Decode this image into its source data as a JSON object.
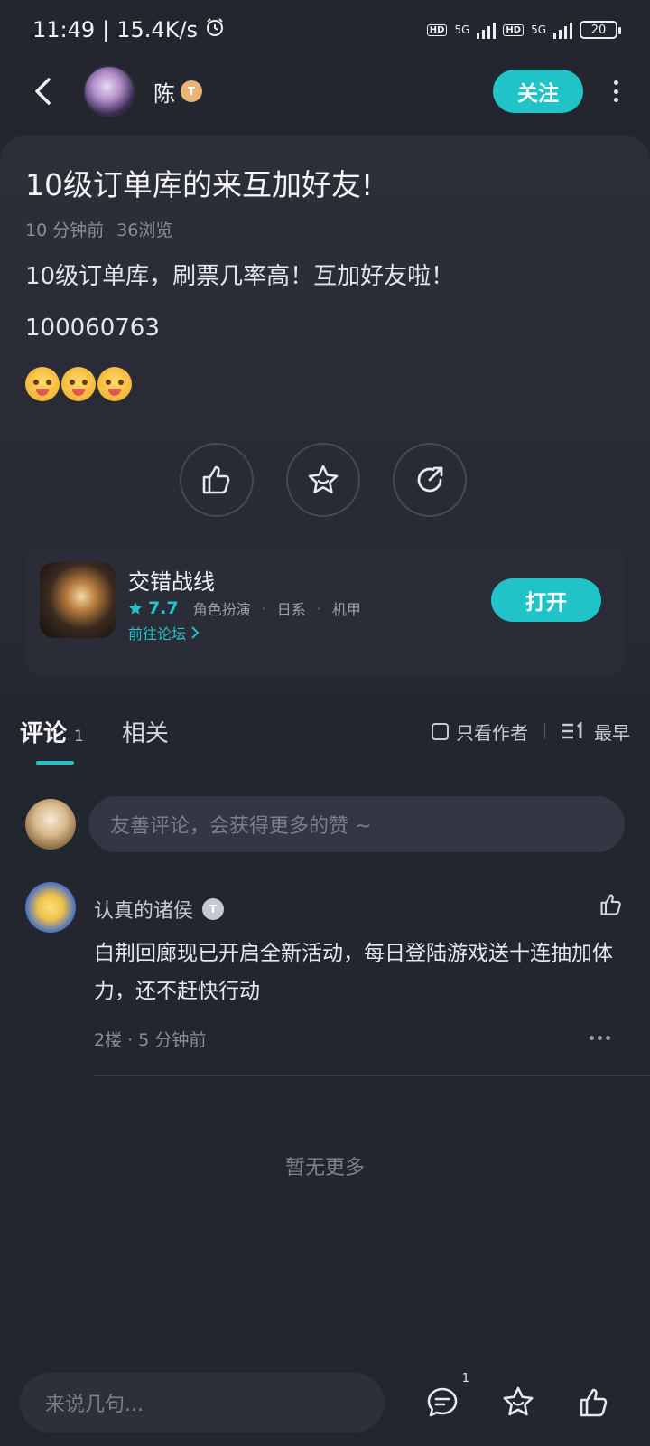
{
  "status_bar": {
    "time": "11:49",
    "speed": "15.4K/s",
    "hd1": "HD",
    "net1": "5G",
    "hd2": "HD",
    "net2": "5G",
    "battery": "20"
  },
  "header": {
    "username": "陈",
    "badge": "T",
    "follow_label": "关注"
  },
  "post": {
    "title": "10级订单库的来互加好友!",
    "time_ago": "10 分钟前",
    "views": "36浏览",
    "body": "10级订单库，刷票几率高！互加好友啦！",
    "id_line": "100060763",
    "emoji_count": 3
  },
  "game": {
    "name": "交错战线",
    "rating": "7.7",
    "tag1": "角色扮演",
    "tag2": "日系",
    "tag3": "机甲",
    "forum_link": "前往论坛",
    "open_label": "打开"
  },
  "tabs": {
    "comments_label": "评论",
    "comments_count": "1",
    "related_label": "相关",
    "author_only_label": "只看作者",
    "sort_label": "最早"
  },
  "comment_input": {
    "placeholder": "友善评论，会获得更多的赞 ~"
  },
  "comments": [
    {
      "author": "认真的诸侯",
      "badge": "T",
      "text": "白荆回廊现已开启全新活动，每日登陆游戏送十连抽加体力，还不赶快行动",
      "floor": "2楼",
      "time_ago": "5 分钟前"
    }
  ],
  "footer_note": "暂无更多",
  "bottom_bar": {
    "placeholder": "来说几句...",
    "comment_count": "1"
  },
  "colors": {
    "accent": "#1fc3c8",
    "background": "#23262f",
    "card": "#2c2f39"
  }
}
